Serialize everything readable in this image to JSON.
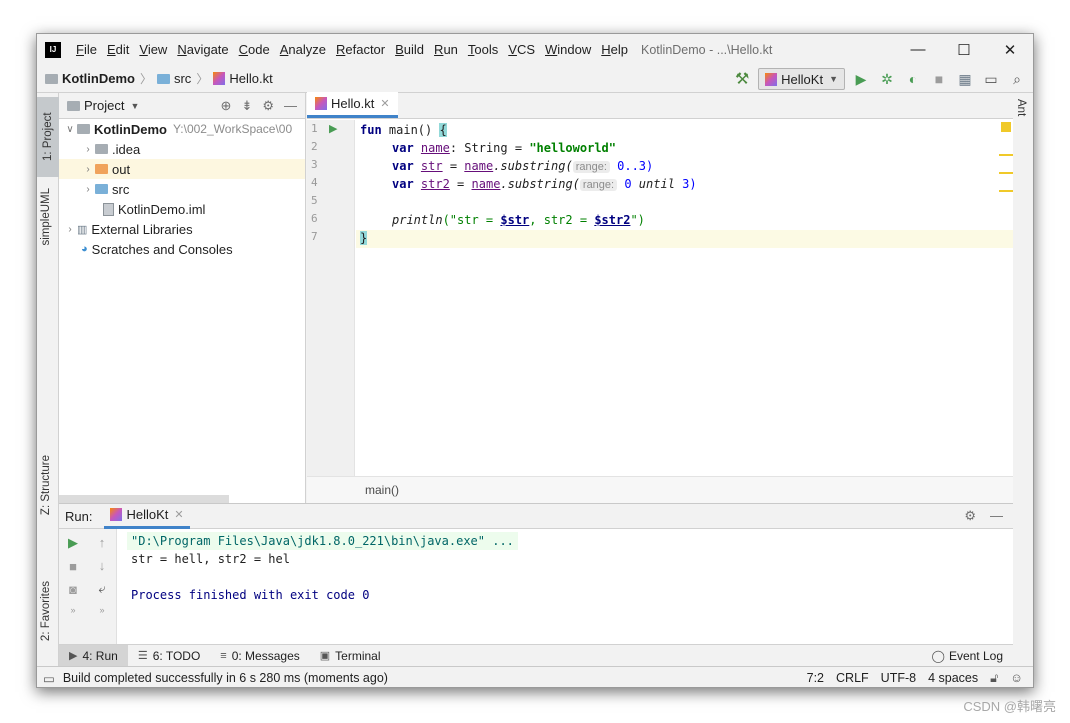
{
  "menubar": {
    "items": [
      "File",
      "Edit",
      "View",
      "Navigate",
      "Code",
      "Analyze",
      "Refactor",
      "Build",
      "Run",
      "Tools",
      "VCS",
      "Window",
      "Help"
    ],
    "window_title": "KotlinDemo - ...\\Hello.kt",
    "controls": {
      "minimize": "—",
      "maximize": "☐",
      "close": "✕"
    }
  },
  "navbar": {
    "crumbs": [
      "KotlinDemo",
      "src",
      "Hello.kt"
    ],
    "run_config": "HelloKt"
  },
  "left_stripe": {
    "project_tab": "1: Project",
    "uml_tab": "simpleUML",
    "structure_tab": "Z: Structure",
    "favorites_tab": "2: Favorites"
  },
  "right_stripe": {
    "ant_tab": "Ant"
  },
  "project_panel": {
    "title": "Project",
    "tree": [
      {
        "name": "KotlinDemo",
        "hint": "Y:\\002_WorkSpace\\00"
      },
      {
        "name": ".idea"
      },
      {
        "name": "out"
      },
      {
        "name": "src"
      },
      {
        "name": "KotlinDemo.iml"
      },
      {
        "name": "External Libraries"
      },
      {
        "name": "Scratches and Consoles"
      }
    ]
  },
  "editor": {
    "tab_label": "Hello.kt",
    "line_numbers": [
      "1",
      "2",
      "3",
      "4",
      "5",
      "6",
      "7"
    ],
    "code": {
      "l1_kw": "fun",
      "l1_name": " main() ",
      "l1_brace": "{",
      "l2_kw": "var",
      "l2_var": "name",
      "l2_type": ": String = ",
      "l2_str": "\"helloworld\"",
      "l3_kw": "var",
      "l3_var": "str",
      "l3_eq": " = ",
      "l3_recv": "name",
      "l3_call": ".substring(",
      "l3_hint": "range:",
      "l3_args": " 0..3)",
      "l4_kw": "var",
      "l4_var": "str2",
      "l4_eq": " = ",
      "l4_recv": "name",
      "l4_call": ".substring(",
      "l4_hint": "range:",
      "l4_args_a": " 0 ",
      "l4_until": "until",
      "l4_args_b": " 3)",
      "l6_fn": "println",
      "l6_open": "(\"str = ",
      "l6_t1": "$str",
      "l6_mid": ", str2 = ",
      "l6_t2": "$str2",
      "l6_close": "\")",
      "l7_brace": "}"
    },
    "breadcrumb": "main()"
  },
  "run_panel": {
    "label": "Run:",
    "tab": "HelloKt",
    "console": [
      "\"D:\\Program Files\\Java\\jdk1.8.0_221\\bin\\java.exe\" ...",
      "str = hell, str2 = hel",
      "Process finished with exit code 0"
    ]
  },
  "tool_windows": {
    "run": "4: Run",
    "todo": "6: TODO",
    "messages": "0: Messages",
    "terminal": "Terminal",
    "event_log": "Event Log"
  },
  "statusbar": {
    "message": "Build completed successfully in 6 s 280 ms (moments ago)",
    "position": "7:2",
    "line_sep": "CRLF",
    "encoding": "UTF-8",
    "indent": "4 spaces"
  },
  "watermark": "CSDN @韩曙亮"
}
